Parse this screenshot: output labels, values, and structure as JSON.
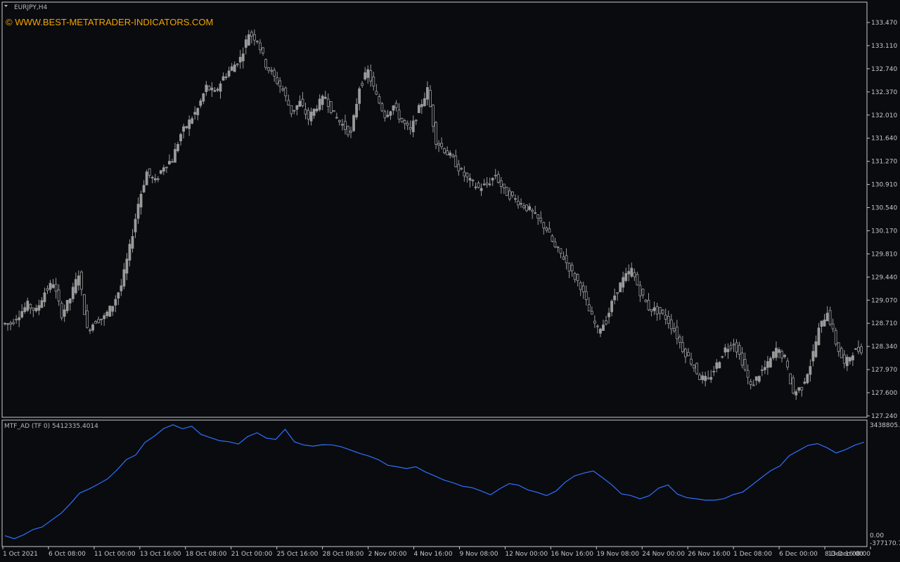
{
  "symbol_label": "EURJPY,H4",
  "watermark": "© WWW.BEST-METATRADER-INDICATORS.COM",
  "indicator_label": "MTF_AD (TF 0) 5412335.4014",
  "colors": {
    "background": "#0a0b0f",
    "frame": "#c8c8c8",
    "candle": "#9a9a9a",
    "indicator_line": "#2f6fff",
    "watermark": "#f0a500"
  },
  "chart_data": [
    {
      "type": "candlestick",
      "title": "EURJPY,H4",
      "ylim": [
        127.24,
        133.6
      ],
      "price_ticks": [
        "133.470",
        "133.110",
        "132.740",
        "132.370",
        "132.010",
        "131.640",
        "131.270",
        "130.910",
        "130.540",
        "130.170",
        "129.810",
        "129.440",
        "129.070",
        "128.710",
        "128.340",
        "127.970",
        "127.600",
        "127.240"
      ],
      "x_ticks": [
        "1 Oct 2021",
        "6 Oct 08:00",
        "11 Oct 00:00",
        "13 Oct 16:00",
        "18 Oct 08:00",
        "21 Oct 00:00",
        "25 Oct 16:00",
        "28 Oct 08:00",
        "2 Nov 00:00",
        "4 Nov 16:00",
        "9 Nov 08:00",
        "12 Nov 00:00",
        "16 Nov 16:00",
        "19 Nov 08:00",
        "24 Nov 00:00",
        "26 Nov 16:00",
        "1 Dec 08:00",
        "6 Dec 00:00",
        "8 Dec 16:00",
        "13 Dec 08:00"
      ],
      "series": [
        {
          "values": [
            128.7,
            128.85,
            129.0,
            128.9,
            129.2,
            129.35,
            128.85,
            129.1,
            129.5,
            128.6,
            128.75,
            128.8,
            129.0,
            129.3,
            129.9,
            130.6,
            131.1,
            130.95,
            131.2,
            131.3,
            131.7,
            131.9,
            132.1,
            132.45,
            132.35,
            132.6,
            132.75,
            132.9,
            133.3,
            133.2,
            132.8,
            132.6,
            132.4,
            132.05,
            132.2,
            131.95,
            132.15,
            132.3,
            132.0,
            131.85,
            131.7,
            132.45,
            132.7,
            132.3,
            132.0,
            132.15,
            131.9,
            131.75,
            132.1,
            132.4,
            131.6,
            131.45,
            131.3,
            131.1,
            130.95,
            130.85,
            130.9,
            131.05,
            130.8,
            130.7,
            130.6,
            130.5,
            130.35,
            130.2,
            129.9,
            129.75,
            129.5,
            129.3,
            128.9,
            128.6,
            128.75,
            129.15,
            129.4,
            129.55,
            129.2,
            128.95,
            128.9,
            128.8,
            128.6,
            128.3,
            128.1,
            127.85,
            127.8,
            128.05,
            128.3,
            128.4,
            128.1,
            127.7,
            127.9,
            128.05,
            128.3,
            128.15,
            127.6,
            127.7,
            128.05,
            128.6,
            128.9,
            128.4,
            128.05,
            128.25,
            128.3
          ]
        }
      ]
    },
    {
      "type": "line",
      "title": "MTF_AD (TF 0) 5412335.4014",
      "ylim": [
        -377170,
        3438050
      ],
      "y_ticks": [
        "3438805.4114",
        "0.00",
        "-377170.7762"
      ],
      "series": [
        {
          "values": [
            -150000,
            -260000,
            -100000,
            80000,
            160000,
            350000,
            600000,
            900000,
            1220000,
            1380000,
            1520000,
            1680000,
            1960000,
            2320000,
            2480000,
            2880000,
            3080000,
            3320000,
            3460000,
            3300000,
            3420000,
            3120000,
            3060000,
            2940000,
            2900000,
            2820000,
            3060000,
            3180000,
            3000000,
            2980000,
            3280000,
            2920000,
            2820000,
            2760000,
            2780000,
            2820000,
            2720000,
            2620000,
            2500000,
            2440000,
            2300000,
            2120000,
            2080000,
            2020000,
            2100000,
            1900000,
            1780000,
            1640000,
            1560000,
            1460000,
            1400000,
            1320000,
            1200000,
            1380000,
            1560000,
            1500000,
            1340000,
            1240000,
            1160000,
            1320000,
            1580000,
            1780000,
            1860000,
            1980000,
            1720000,
            1520000,
            1220000,
            1140000,
            1060000,
            1180000,
            1400000,
            1480000,
            1200000,
            1120000,
            1080000,
            1020000,
            980000,
            1060000,
            1180000,
            1260000,
            1500000,
            1760000,
            1960000,
            2120000,
            2420000,
            2640000,
            2760000,
            2820000,
            2700000,
            2560000,
            2620000,
            2780000,
            2880000
          ]
        }
      ]
    }
  ]
}
